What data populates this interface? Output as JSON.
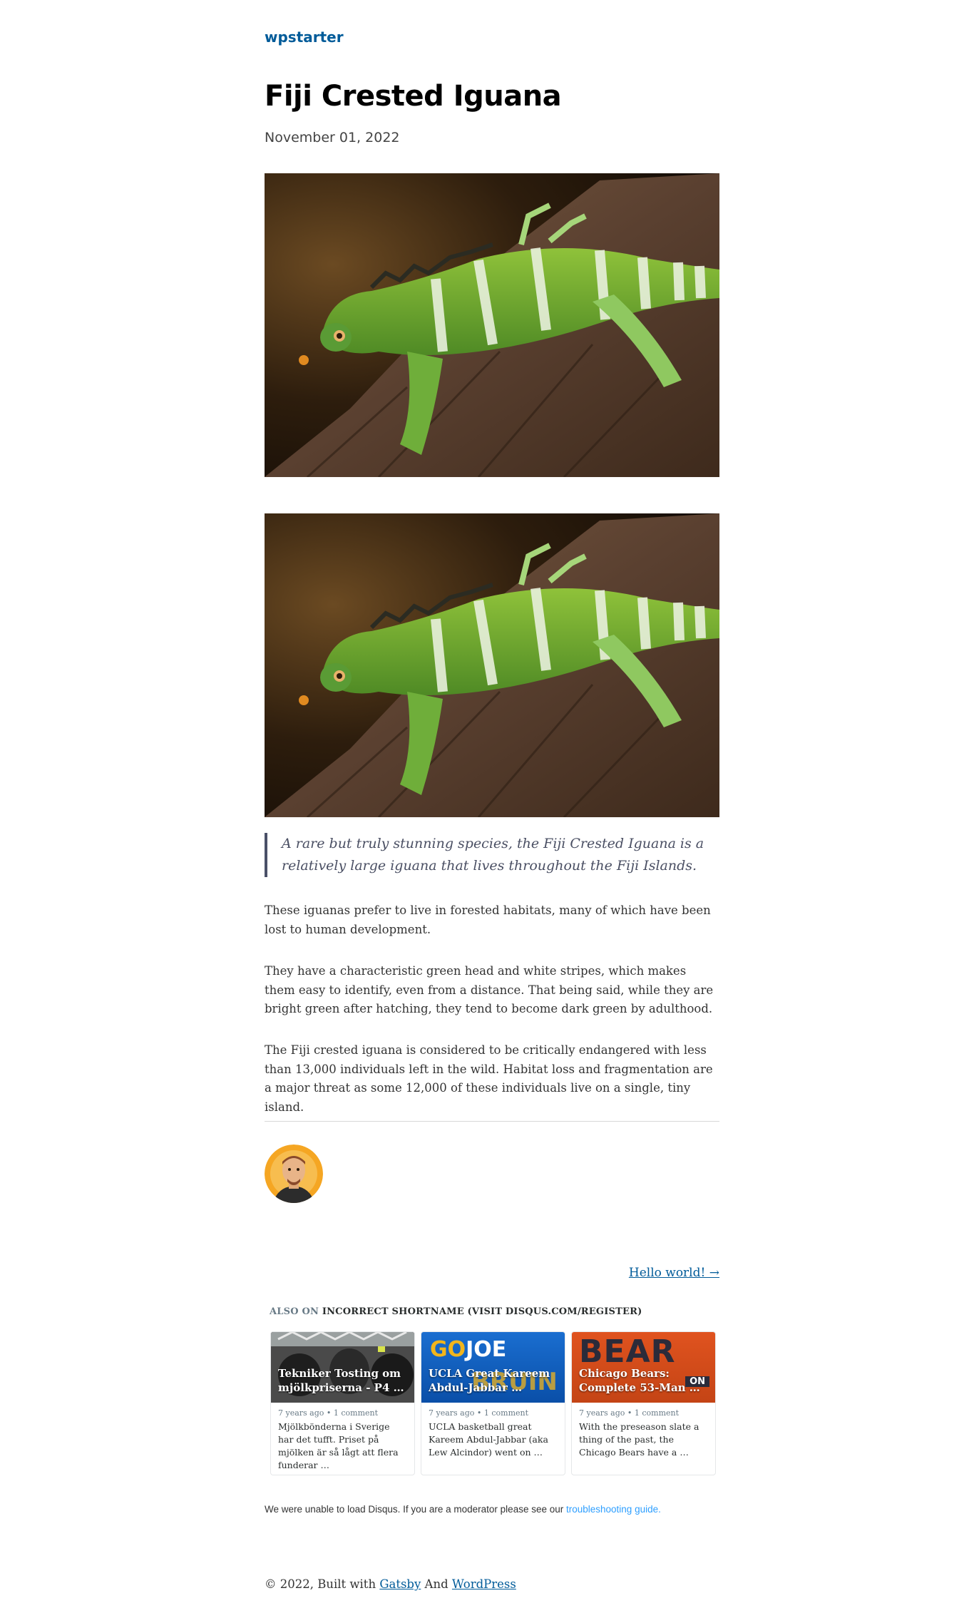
{
  "site": {
    "title": "wpstarter"
  },
  "post": {
    "title": "Fiji Crested Iguana",
    "date": "November 01, 2022",
    "quote": "A rare but truly stunning species, the Fiji Crested Iguana is a relatively large iguana that lives throughout the Fiji Islands.",
    "paragraphs": [
      "These iguanas prefer to live in forested habitats, many of which have been lost to human development.",
      "They have a characteristic green head and white stripes, which makes them easy to identify, even from a distance. That being said, while they are bright green after hatching, they tend to become dark green by adulthood.",
      "The Fiji crested iguana is considered to be critically endangered with less than 13,000 individuals left in the wild. Habitat loss and fragmentation are a major threat as some 12,000 of these individuals live on a single, tiny island."
    ]
  },
  "nav": {
    "next": "Hello world! →"
  },
  "disqus": {
    "also_on_prefix": "ALSO ON",
    "also_on_site": "INCORRECT SHORTNAME (VISIT DISQUS.COM/REGISTER)",
    "cards": [
      {
        "title": "Tekniker Tosting om\nmjölkpriserna - P4 …",
        "meta": "7 years ago • 1 comment",
        "excerpt": "Mjölkbönderna i Sverige har det tufft. Priset på mjölken är så lågt att flera funderar …"
      },
      {
        "title": "UCLA Great Kareem\nAbdul-Jabbar …",
        "meta": "7 years ago • 1 comment",
        "excerpt": "UCLA basketball great Kareem Abdul-Jabbar (aka Lew Alcindor) went on …"
      },
      {
        "title": "Chicago Bears:\nComplete 53-Man …",
        "meta": "7 years ago • 1 comment",
        "excerpt": "With the preseason slate a thing of the past, the Chicago Bears have a …"
      }
    ],
    "card2_logo_a": "GO",
    "card2_logo_b": "JOE",
    "card2_logo_c": "BRUIN",
    "card3_logo": "BEAR",
    "card3_logo_tag": "ON",
    "error_text": "We were unable to load Disqus. If you are a moderator please see our ",
    "error_link": "troubleshooting guide."
  },
  "footer": {
    "prefix": "© 2022, Built with ",
    "gatsby": "Gatsby",
    "and": " And ",
    "wordpress": "WordPress"
  },
  "icons": {
    "avatar": "avatar-illustration",
    "hero": "iguana-photo"
  },
  "colors": {
    "link": "#005b99",
    "quote_border": "#4a5068",
    "disqus_link": "#2e9fff"
  }
}
